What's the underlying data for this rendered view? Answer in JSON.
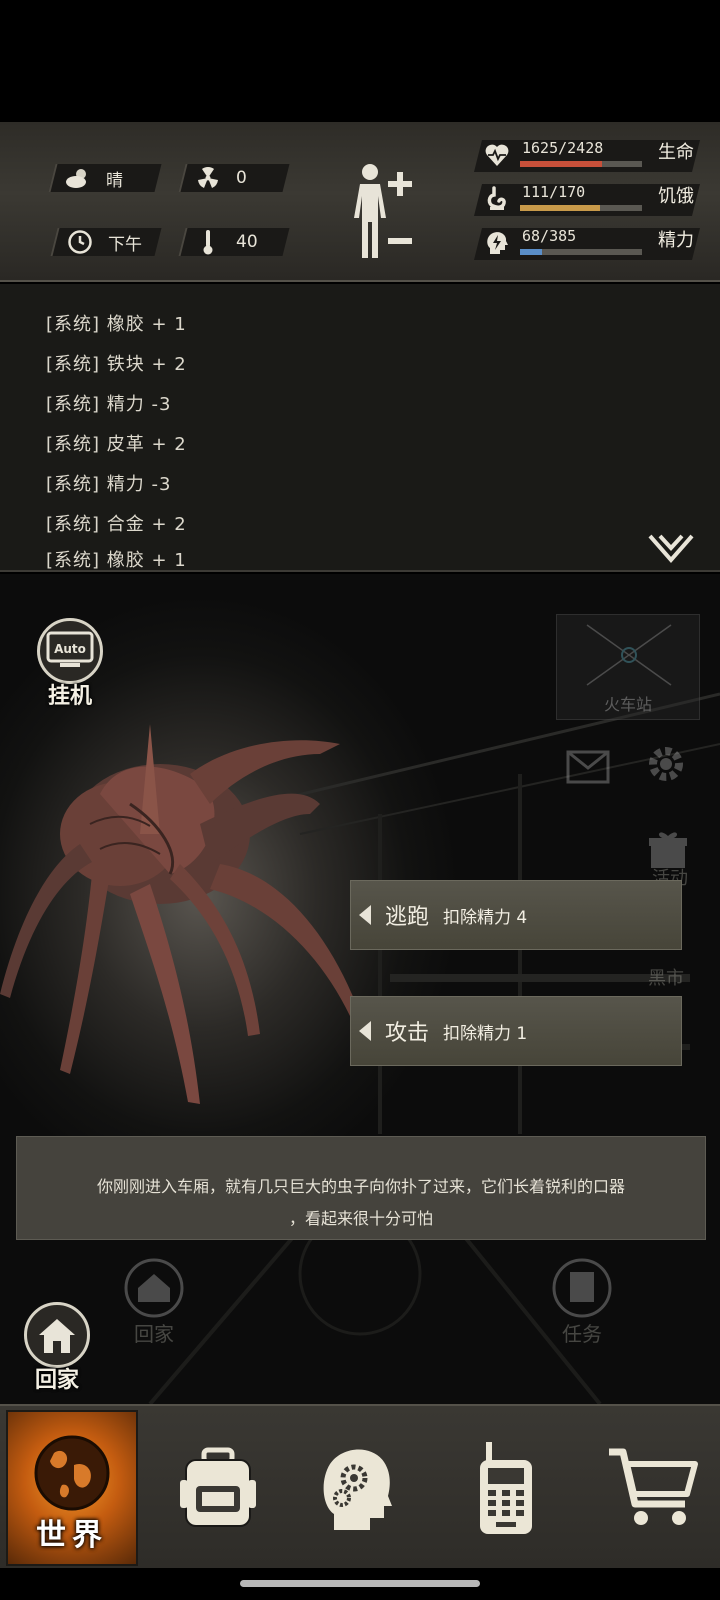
{
  "status": {
    "weather": "晴",
    "radiation": "0",
    "time_of_day": "下午",
    "temperature": "40",
    "stats": [
      {
        "label": "生命",
        "value": "1625/2428",
        "fraction": 0.669,
        "color": "#c8503a",
        "icon": "heartbeat-icon"
      },
      {
        "label": "饥饿",
        "value": "111/170",
        "fraction": 0.653,
        "color": "#c89a4a",
        "icon": "stomach-icon"
      },
      {
        "label": "精力",
        "value": "68/385",
        "fraction": 0.177,
        "color": "#5a8ec8",
        "icon": "head-lightning-icon"
      }
    ]
  },
  "log": {
    "lines": [
      "[系统] 橡胶 + 1",
      "[系统] 铁块 + 2",
      "[系统] 精力 -3",
      "[系统] 皮革 + 2",
      "[系统] 精力 -3",
      "[系统] 合金 + 2",
      "[系统] 橡胶 + 1"
    ]
  },
  "scene": {
    "auto_label": "挂机",
    "auto_text": "Auto",
    "minimap_label": "火车站",
    "blackmarket_label": "黑市",
    "gift_label": "活动",
    "home_label_faded": "回家",
    "task_label": "任务",
    "home_label": "回家"
  },
  "actions": [
    {
      "name": "逃跑",
      "cost": "扣除精力 4"
    },
    {
      "name": "攻击",
      "cost": "扣除精力 1"
    }
  ],
  "story": {
    "line1": "你刚刚进入车厢，就有几只巨大的虫子向你扑了过来，它们长着锐利的口器",
    "line2": "，看起来很十分可怕"
  },
  "nav": {
    "world_label": "世界"
  }
}
